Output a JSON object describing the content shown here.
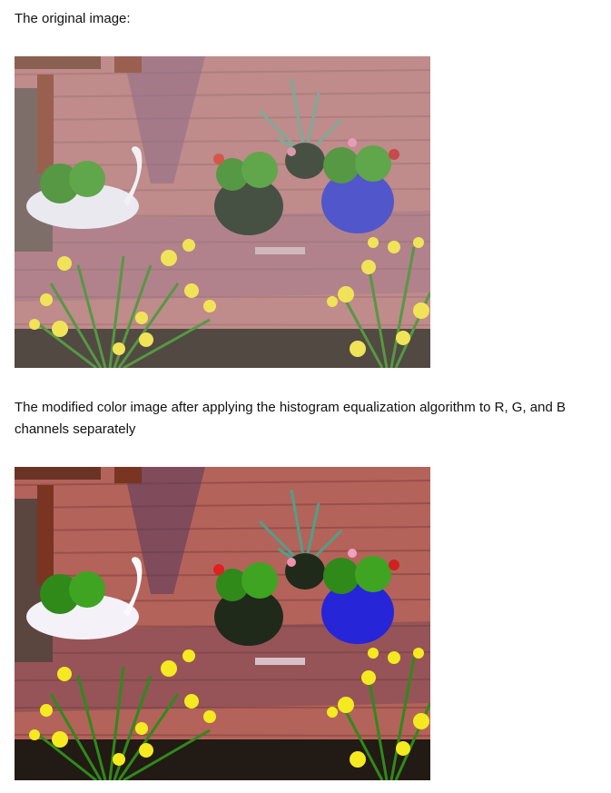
{
  "captions": {
    "original": "The original image:",
    "modified": "The modified color image after applying the histogram equalization algorithm to R, G, and B channels separately"
  },
  "images": {
    "original_alt": "Original photo of potted plants and daffodils on a deck",
    "modified_alt": "Histogram-equalized photo of potted plants and daffodils on a deck"
  },
  "colors": {
    "original_deck": "#b77b7b",
    "modified_deck": "#b4635a",
    "pot_blue": "#3a3fc4",
    "pot_dark": "#2d3a2a",
    "daffodil": "#f0e040",
    "foliage": "#3f8a2a"
  }
}
